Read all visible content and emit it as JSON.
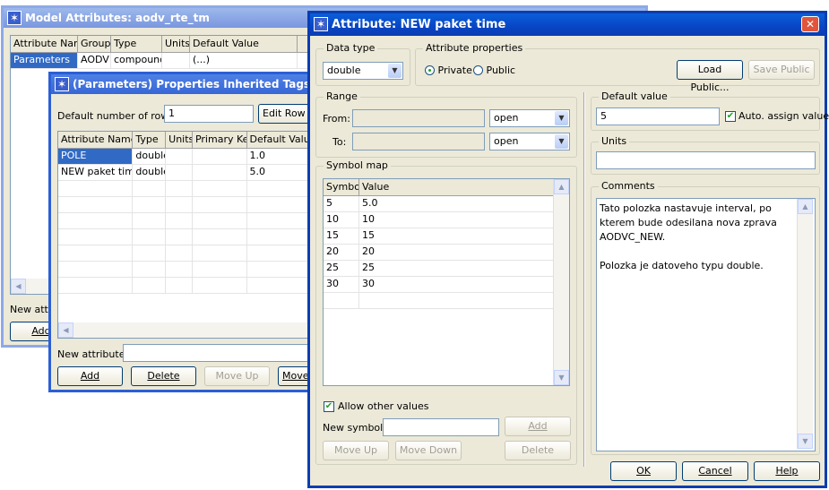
{
  "model_window": {
    "title": "Model Attributes: aodv_rte_tm",
    "columns": [
      "Attribute Name",
      "Group",
      "Type",
      "Units",
      "Default Value"
    ],
    "rows": [
      {
        "name": "Parameters",
        "group": "AODV",
        "type": "compound",
        "units": "",
        "default": "(...)"
      }
    ],
    "new_attribute_label": "New attrib",
    "add_button": "Add"
  },
  "params_window": {
    "title": "(Parameters) Properties Inherited Tags [ ]",
    "default_rows_label": "Default number of rows:",
    "default_rows_value": "1",
    "edit_row_button": "Edit Row C",
    "columns": [
      "Attribute Name",
      "Type",
      "Units",
      "Primary Key",
      "Default Value"
    ],
    "rows": [
      {
        "name": "POLE",
        "type": "double",
        "units": "",
        "primary_key": "",
        "default": "1.0"
      },
      {
        "name": "NEW paket time",
        "type": "double",
        "units": "",
        "primary_key": "",
        "default": "5.0"
      }
    ],
    "new_attribute_label": "New attribute:",
    "buttons": {
      "add": "Add",
      "delete": "Delete",
      "move_up": "Move Up",
      "move_down": "Move"
    }
  },
  "attr_dialog": {
    "title": "Attribute: NEW paket time",
    "data_type": {
      "group": "Data type",
      "value": "double"
    },
    "attribute_properties": {
      "group": "Attribute properties",
      "private": "Private",
      "public": "Public",
      "selected": "Private"
    },
    "load_public": "Load Public...",
    "save_public": "Save Public",
    "range": {
      "group": "Range",
      "from_label": "From:",
      "to_label": "To:",
      "from_mode": "open",
      "to_mode": "open"
    },
    "symbol_map": {
      "group": "Symbol map",
      "columns": [
        "Symbol",
        "Value"
      ],
      "rows": [
        {
          "symbol": "5",
          "value": "5.0"
        },
        {
          "symbol": "10",
          "value": "10"
        },
        {
          "symbol": "15",
          "value": "15"
        },
        {
          "symbol": "20",
          "value": "20"
        },
        {
          "symbol": "25",
          "value": "25"
        },
        {
          "symbol": "30",
          "value": "30"
        }
      ],
      "allow_other_values": "Allow other values",
      "new_symbol_label": "New symbol:",
      "add_button": "Add",
      "move_up": "Move Up",
      "move_down": "Move Down",
      "delete": "Delete"
    },
    "default_value": {
      "group": "Default value",
      "value": "5",
      "auto_assign": "Auto. assign value"
    },
    "units": {
      "group": "Units",
      "value": ""
    },
    "comments": {
      "group": "Comments",
      "text": "Tato polozka nastavuje interval, po kterem bude odesilana nova zprava AODVC_NEW.\n\nPolozka je datoveho typu double."
    },
    "ok": "OK",
    "cancel": "Cancel",
    "help": "Help"
  }
}
